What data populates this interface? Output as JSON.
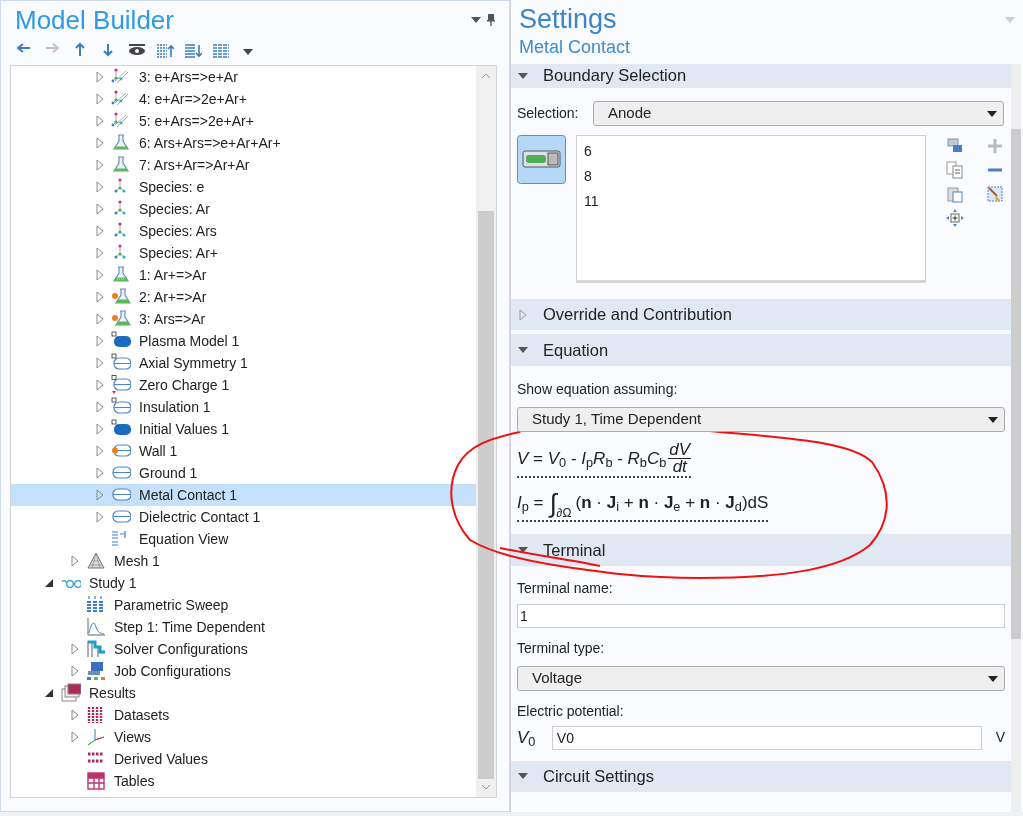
{
  "model_builder": {
    "title": "Model Builder",
    "toolbar": [
      {
        "kind": "back",
        "disabled": false
      },
      {
        "kind": "forward",
        "disabled": true
      },
      {
        "kind": "up",
        "disabled": false
      },
      {
        "kind": "down",
        "disabled": false
      },
      {
        "kind": "show",
        "disabled": false
      },
      {
        "kind": "collapse",
        "disabled": false
      },
      {
        "kind": "expand",
        "disabled": false
      },
      {
        "kind": "list",
        "disabled": false
      },
      {
        "kind": "menu",
        "disabled": false
      }
    ],
    "tree": [
      {
        "children": [
          {
            "children": [
              {
                "label": "3: e+Ars=>e+Ar",
                "kind": "reaction",
                "expanded": false,
                "selected": false
              },
              {
                "label": "4: e+Ar=>2e+Ar+",
                "kind": "reaction",
                "expanded": false,
                "selected": false
              },
              {
                "label": "5: e+Ars=>2e+Ar+",
                "kind": "reaction",
                "expanded": false,
                "selected": false
              },
              {
                "label": "6: Ars+Ars=>e+Ar+Ar+",
                "kind": "flask",
                "expanded": false,
                "selected": false
              },
              {
                "label": "7: Ars+Ar=>Ar+Ar",
                "kind": "flask",
                "expanded": false,
                "selected": false
              },
              {
                "label": "Species: e",
                "kind": "species",
                "expanded": false,
                "selected": false
              },
              {
                "label": "Species: Ar",
                "kind": "species",
                "expanded": false,
                "selected": false
              },
              {
                "label": "Species: Ars",
                "kind": "species",
                "expanded": false,
                "selected": false
              },
              {
                "label": "Species: Ar+",
                "kind": "species",
                "expanded": false,
                "selected": false
              },
              {
                "label": "1: Ar+=>Ar",
                "kind": "flask-dots",
                "expanded": false,
                "selected": false
              },
              {
                "label": "2: Ar+=>Ar",
                "kind": "flask-orange",
                "expanded": false,
                "selected": false
              },
              {
                "label": "3: Ars=>Ar",
                "kind": "flask-orange",
                "expanded": false,
                "selected": false
              },
              {
                "label": "Plasma Model 1",
                "kind": "domain",
                "expanded": false,
                "selected": false
              },
              {
                "label": "Axial Symmetry 1",
                "kind": "boundary",
                "expanded": false,
                "selected": false
              },
              {
                "label": "Zero Charge 1",
                "kind": "boundary-charge",
                "expanded": false,
                "selected": false
              },
              {
                "label": "Insulation 1",
                "kind": "boundary",
                "expanded": false,
                "selected": false
              },
              {
                "label": "Initial Values 1",
                "kind": "domain",
                "expanded": false,
                "selected": false
              },
              {
                "label": "Wall 1",
                "kind": "boundary-dot",
                "expanded": false,
                "selected": false
              },
              {
                "label": "Ground 1",
                "kind": "boundary-plain",
                "expanded": false,
                "selected": false
              },
              {
                "label": "Metal Contact 1",
                "kind": "boundary-plain",
                "expanded": false,
                "selected": true
              },
              {
                "label": "Dielectric Contact 1",
                "kind": "boundary-plain",
                "expanded": false,
                "selected": false
              },
              {
                "label": "Equation View",
                "kind": "equation",
                "selected": false
              }
            ]
          },
          {
            "label": "Mesh 1",
            "kind": "mesh",
            "expanded": false,
            "selected": false
          }
        ]
      },
      {
        "label": "Study 1",
        "kind": "study",
        "expanded": true,
        "selected": false,
        "children": [
          {
            "label": "Parametric Sweep",
            "kind": "sweep",
            "selected": false
          },
          {
            "label": "Step 1: Time Dependent",
            "kind": "step",
            "selected": false
          },
          {
            "label": "Solver Configurations",
            "kind": "solver",
            "expanded": false,
            "selected": false
          },
          {
            "label": "Job Configurations",
            "kind": "job",
            "expanded": false,
            "selected": false
          }
        ]
      },
      {
        "label": "Results",
        "kind": "results",
        "expanded": true,
        "selected": false,
        "children": [
          {
            "label": "Datasets",
            "kind": "datasets",
            "expanded": false,
            "selected": false
          },
          {
            "label": "Views",
            "kind": "views",
            "expanded": false,
            "selected": false
          },
          {
            "label": "Derived Values",
            "kind": "derived",
            "selected": false
          },
          {
            "label": "Tables",
            "kind": "tables",
            "selected": false
          }
        ]
      }
    ]
  },
  "settings": {
    "title": "Settings",
    "subtitle": "Metal Contact",
    "sections": [
      {
        "kind": "selection",
        "title": "Boundary Selection",
        "expanded": true,
        "selection_label": "Selection:",
        "selection_value": "Anode",
        "items": [
          "6",
          "8",
          "11"
        ]
      },
      {
        "kind": "plain",
        "title": "Override and Contribution",
        "expanded": false
      },
      {
        "kind": "equation",
        "title": "Equation",
        "expanded": true,
        "assume_label": "Show equation assuming:",
        "assume_value": "Study 1, Time Dependent",
        "eq1": {
          "lhs": "*V* = *V*$_{0}$ - *I*$_{p}$*R*$_{b}$ - *R*$_{b}$*C*$_{b}$",
          "numerator": "dV",
          "denominator": "dt"
        },
        "eq2": {
          "lhs": "*I*$_{p}$ =",
          "integral": "∫",
          "limit": "∂Ω",
          "body": "(**n** · **J**$_{i}$ + **n** · **J**$_{e}$ + **n** · **J**$_{d}$)dS"
        }
      },
      {
        "kind": "terminal",
        "title": "Terminal",
        "expanded": true,
        "name_label": "Terminal name:",
        "name_value": "1",
        "type_label": "Terminal type:",
        "type_value": "Voltage",
        "potential_label": "Electric potential:",
        "potential_symbol": "*V*$_{0}$",
        "potential_value": "V0",
        "potential_unit": "V"
      },
      {
        "kind": "plain",
        "title": "Circuit Settings",
        "expanded": true
      }
    ]
  }
}
